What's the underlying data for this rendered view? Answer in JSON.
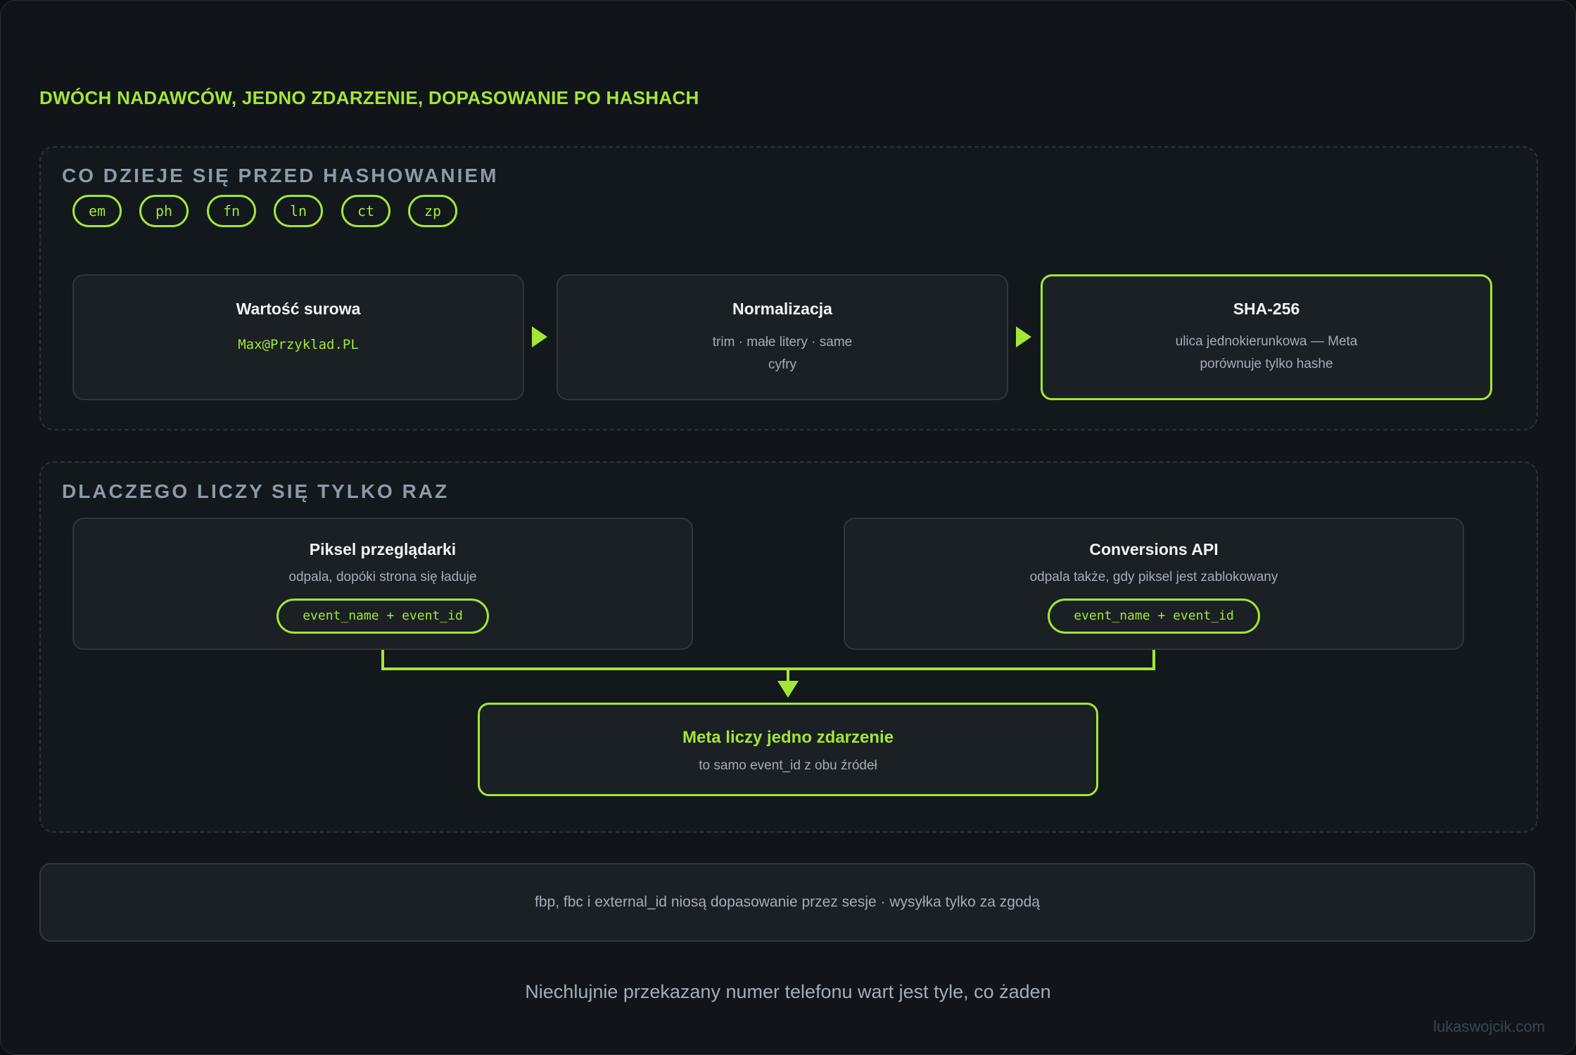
{
  "title": "DWÓCH NADAWCÓW, JEDNO ZDARZENIE, DOPASOWANIE PO HASHACH",
  "section1": {
    "title": "CO DZIEJE SIĘ PRZED HASHOWANIEM",
    "tags": [
      "em",
      "ph",
      "fn",
      "ln",
      "ct",
      "zp"
    ],
    "steps": [
      {
        "title": "Wartość surowa",
        "value": "Max@Przyklad.PL"
      },
      {
        "title": "Normalizacja",
        "line1": "trim · małe litery · same",
        "line2": "cyfry"
      },
      {
        "title": "SHA-256",
        "line1": "ulica jednokierunkowa — Meta",
        "line2": "porównuje tylko hashe"
      }
    ]
  },
  "section2": {
    "title": "DLACZEGO LICZY SIĘ TYLKO RAZ",
    "sources": [
      {
        "title": "Piksel przeglądarki",
        "desc": "odpala, dopóki strona się ładuje",
        "code": "event_name + event_id"
      },
      {
        "title": "Conversions API",
        "desc": "odpala także, gdy piksel jest zablokowany",
        "code": "event_name + event_id"
      }
    ],
    "result": {
      "title": "Meta liczy jedno zdarzenie",
      "desc": "to samo event_id z obu źródeł"
    }
  },
  "note": "fbp, fbc i external_id niosą dopasowanie przez sesje · wysyłka tylko za zgodą",
  "footer": "Niechlujnie przekazany numer telefonu wart jest tyle, co żaden",
  "signature": "lukaswojcik.com",
  "colors": {
    "accent": "#a3e635",
    "background": "#111519",
    "card": "#1b2024",
    "muted": "#8d9aab"
  }
}
